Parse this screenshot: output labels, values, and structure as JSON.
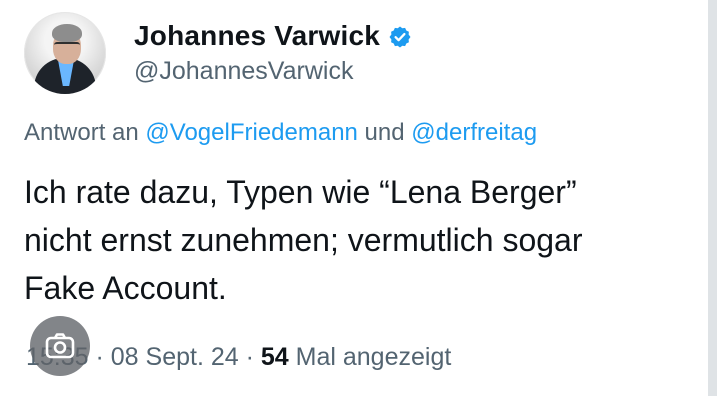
{
  "author": {
    "display_name": "Johannes Varwick",
    "handle": "@JohannesVarwick",
    "verified_icon": "verified-badge-icon"
  },
  "reply": {
    "prefix": "Antwort an ",
    "mention_1": "@VogelFriedemann",
    "connector": " und ",
    "mention_2": "@derfreitag"
  },
  "tweet": {
    "text": "Ich rate dazu, Typen wie “Lena Berger”\nnicht ernst zunehmen; vermutlich sogar\nFake Account."
  },
  "meta": {
    "time": "15:35",
    "sep1": " · ",
    "date": "08 Sept. 24",
    "sep2": " · ",
    "views_count": "54",
    "views_label": " Mal angezeigt"
  },
  "overlay": {
    "icon": "lens-camera-icon"
  },
  "colors": {
    "accent": "#1d9bf0",
    "secondary_text": "#536471",
    "primary_text": "#0f1419"
  }
}
